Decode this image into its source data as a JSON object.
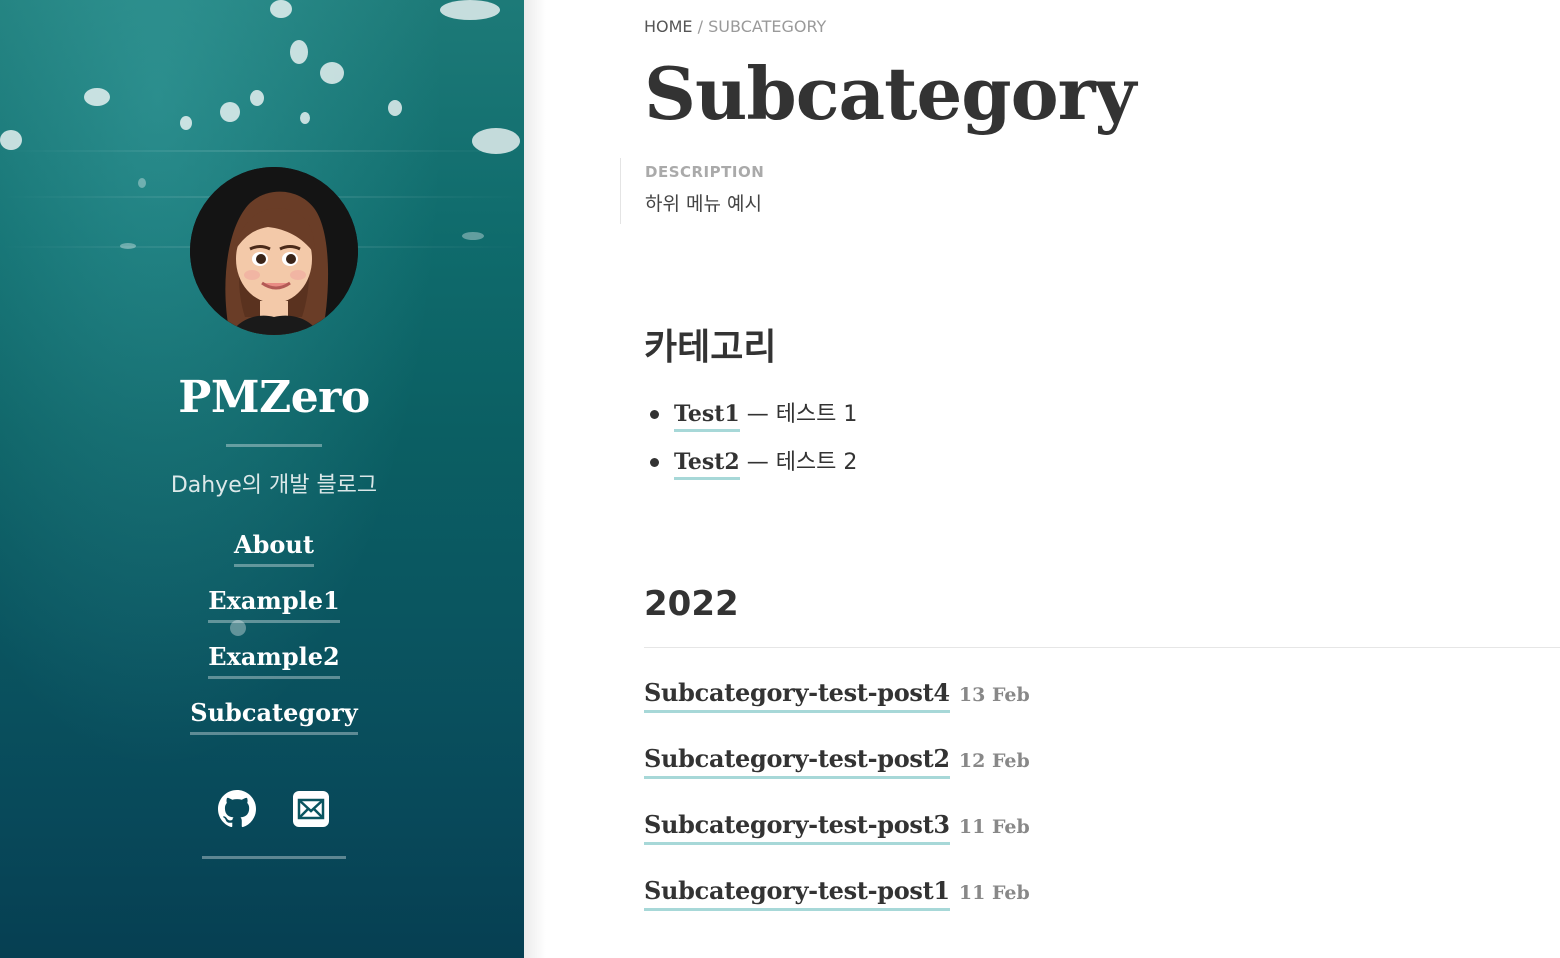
{
  "sidebar": {
    "site_title": "PMZero",
    "tagline": "Dahye의 개발 블로그",
    "nav": [
      "About",
      "Example1",
      "Example2",
      "Subcategory"
    ],
    "social": [
      "github-icon",
      "mail-icon"
    ]
  },
  "breadcrumb": {
    "home": "HOME",
    "separator": "/",
    "current": "SUBCATEGORY"
  },
  "page": {
    "title": "Subcategory",
    "description_label": "DESCRIPTION",
    "description": "하위 메뉴 예시"
  },
  "categories": {
    "heading": "카테고리",
    "items": [
      {
        "name": "Test1",
        "desc": "— 테스트 1"
      },
      {
        "name": "Test2",
        "desc": "— 테스트 2"
      }
    ]
  },
  "archive": {
    "year": "2022",
    "posts": [
      {
        "title": "Subcategory-test-post4",
        "date": "13 Feb"
      },
      {
        "title": "Subcategory-test-post2",
        "date": "12 Feb"
      },
      {
        "title": "Subcategory-test-post3",
        "date": "11 Feb"
      },
      {
        "title": "Subcategory-test-post1",
        "date": "11 Feb"
      }
    ]
  },
  "colors": {
    "accent_underline": "#a7d8d8",
    "sidebar_top": "#1d7a78",
    "sidebar_bottom": "#063f52",
    "text": "#333333"
  }
}
